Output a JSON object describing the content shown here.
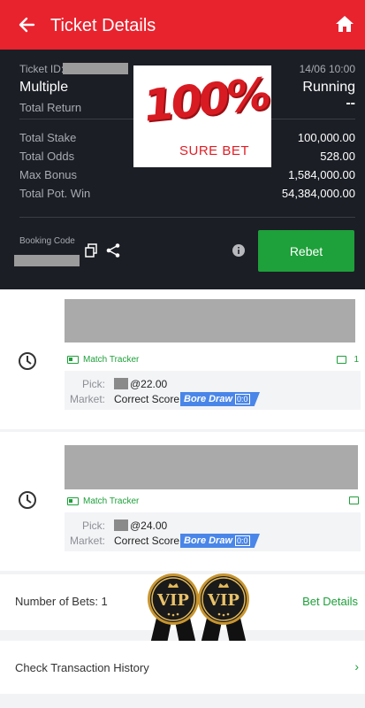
{
  "header": {
    "title": "Ticket Details"
  },
  "summary": {
    "ticket_id_label": "Ticket ID:",
    "date": "14/06 10:00",
    "bet_type": "Multiple",
    "status": "Running",
    "total_return_label": "Total Return",
    "total_return_value": "--",
    "rows": [
      {
        "label": "Total Stake",
        "value": "100,000.00"
      },
      {
        "label": "Total Odds",
        "value": "528.00"
      },
      {
        "label": "Max Bonus",
        "value": "1,584,000.00"
      },
      {
        "label": "Total Pot. Win",
        "value": "54,384,000.00"
      }
    ],
    "booking_code_label": "Booking Code",
    "rebet_label": "Rebet"
  },
  "overlay": {
    "big_text": "100%",
    "sub_text": "SURE BET"
  },
  "bets": [
    {
      "tracker_label": "Match Tracker",
      "comment_count": "1",
      "pick_label": "Pick:",
      "pick_odds": "@22.00",
      "market_label": "Market:",
      "market_value": "Correct Score",
      "tag_label": "Bore Draw",
      "tag_score": "0:0"
    },
    {
      "tracker_label": "Match Tracker",
      "comment_count": "",
      "pick_label": "Pick:",
      "pick_odds": "@24.00",
      "market_label": "Market:",
      "market_value": "Correct Score",
      "tag_label": "Bore Draw",
      "tag_score": "0:0"
    }
  ],
  "footer": {
    "number_of_bets": "Number of Bets: 1",
    "bet_details": "Bet Details",
    "check_history": "Check Transaction History",
    "vip_text": "VIP"
  },
  "colors": {
    "header_red": "#e8232e",
    "dark_bg": "#1b1e25",
    "green": "#1ea03a",
    "tag_blue": "#4a86e8"
  }
}
